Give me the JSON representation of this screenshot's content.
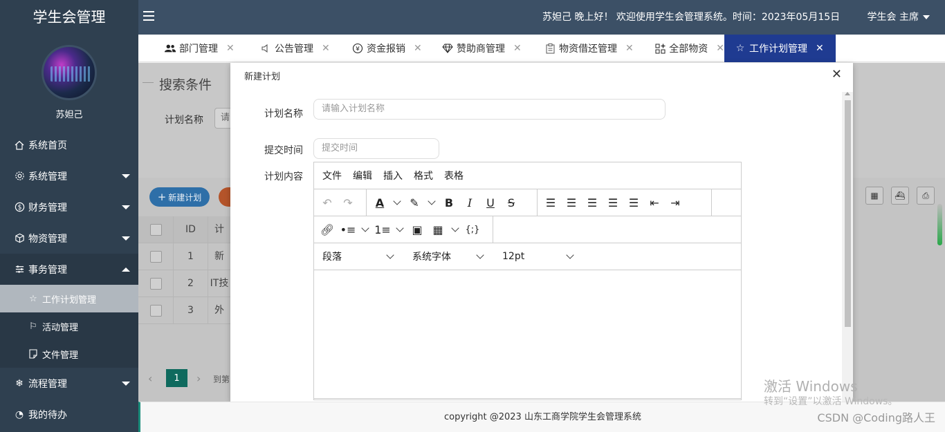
{
  "app": {
    "brand": "学生会管理"
  },
  "user": {
    "name": "苏妲己"
  },
  "header": {
    "greeting": "苏妲己 晚上好！ 欢迎使用学生会管理系统。时间：2023年05月15日",
    "role": "学生会 主席"
  },
  "sidebar": {
    "items": [
      {
        "label": "系统首页",
        "icon": "home-icon"
      },
      {
        "label": "系统管理",
        "icon": "gear-icon"
      },
      {
        "label": "财务管理",
        "icon": "dollar-icon"
      },
      {
        "label": "物资管理",
        "icon": "cube-icon"
      },
      {
        "label": "事务管理",
        "icon": "sliders-icon"
      },
      {
        "label": "流程管理",
        "icon": "snowflake-icon"
      },
      {
        "label": "我的待办",
        "icon": "clock-icon"
      }
    ],
    "submenu": [
      {
        "label": "工作计划管理",
        "icon": "star-icon"
      },
      {
        "label": "活动管理",
        "icon": "flag-icon"
      },
      {
        "label": "文件管理",
        "icon": "file-icon"
      }
    ]
  },
  "tabs": [
    {
      "label": "部门管理",
      "icon": "users-icon"
    },
    {
      "label": "公告管理",
      "icon": "speaker-icon"
    },
    {
      "label": "资金报销",
      "icon": "yen-icon"
    },
    {
      "label": "赞助商管理",
      "icon": "diamond-icon"
    },
    {
      "label": "物资借还管理",
      "icon": "clipboard-icon"
    },
    {
      "label": "全部物资",
      "icon": "grid-plus-icon"
    },
    {
      "label": "工作计划管理",
      "icon": "star-icon"
    }
  ],
  "search": {
    "title": "搜索条件",
    "name_label": "计划名称",
    "name_placeholder": "请"
  },
  "toolbar": {
    "new_label": "新建计划"
  },
  "table": {
    "headers": {
      "id": "ID",
      "name": "计"
    },
    "rows": [
      {
        "id": "1",
        "name": "新"
      },
      {
        "id": "2",
        "name": "IT技"
      },
      {
        "id": "3",
        "name": "外"
      }
    ]
  },
  "pager": {
    "current": "1",
    "goto": "到第"
  },
  "modal": {
    "title": "新建计划",
    "name_label": "计划名称",
    "name_placeholder": "请输入计划名称",
    "time_label": "提交时间",
    "time_placeholder": "提交时间",
    "content_label": "计划内容"
  },
  "editor": {
    "menu": [
      "文件",
      "编辑",
      "插入",
      "格式",
      "表格"
    ],
    "block_format": "段落",
    "font_family": "系统字体",
    "font_size": "12pt"
  },
  "footer": {
    "copyright": "copyright @2023 山东工商学院学生会管理系统"
  },
  "watermarks": {
    "windows_title": "激活 Windows",
    "windows_sub": "转到“设置”以激活 Windows。",
    "csdn": "CSDN @Coding路人王"
  },
  "colors": {
    "sidebar": "#2f4050",
    "header": "#3c5066",
    "active_tab": "#1f3b91",
    "page_active": "#0f6a5e"
  }
}
